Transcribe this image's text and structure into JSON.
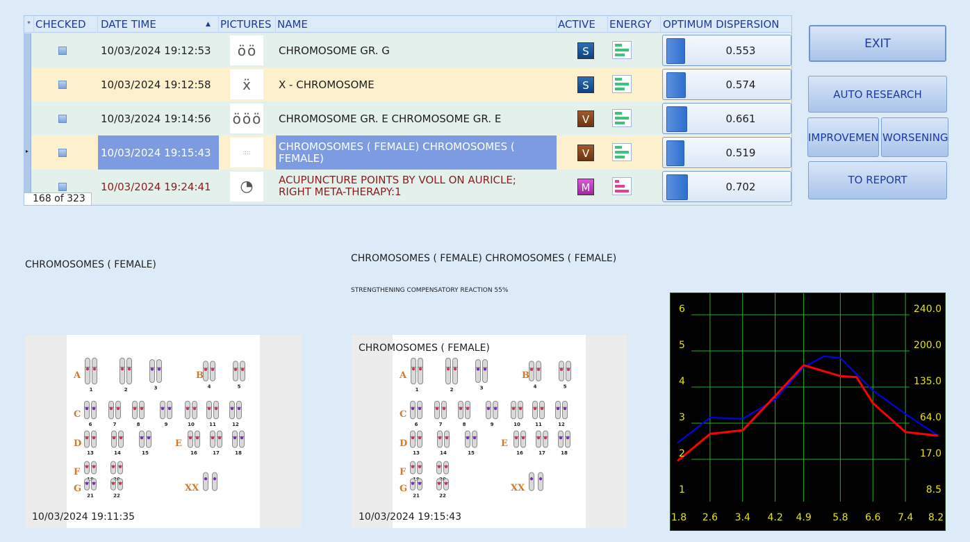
{
  "table": {
    "columns": [
      "CHECKED",
      "DATE  TIME",
      "PICTURES",
      "NAME",
      "ACTIVE",
      "ENERGY",
      "OPTIMUM DISPERSION"
    ],
    "rows": [
      {
        "datetime": "10/03/2024 19:12:53",
        "name": "CHROMOSOME GR. G",
        "active": "S",
        "dispersion": "0.553",
        "bar_level": 0.55
      },
      {
        "datetime": "10/03/2024 19:12:58",
        "name": "X - CHROMOSOME",
        "active": "S",
        "dispersion": "0.574",
        "bar_level": 0.57
      },
      {
        "datetime": "10/03/2024 19:14:56",
        "name": "CHROMOSOME GR. E CHROMOSOME GR. E",
        "active": "V",
        "dispersion": "0.661",
        "bar_level": 0.66
      },
      {
        "datetime": "10/03/2024 19:15:43",
        "name": "CHROMOSOMES ( FEMALE) CHROMOSOMES ( FEMALE)",
        "active": "V",
        "dispersion": "0.519",
        "bar_level": 0.52,
        "selected": true
      },
      {
        "datetime": "10/03/2024 19:24:41",
        "name": "ACUPUNCTURE POINTS BY VOLL ON AURICLE; RIGHT META-THERAPY:1",
        "active": "M",
        "dispersion": "0.702",
        "bar_level": 0.7
      }
    ],
    "counter": "168 of 323"
  },
  "buttons": {
    "exit": "EXIT",
    "auto_research": "AUTO RESEARCH",
    "improvement": "IMPROVEMENT",
    "worsening": "WORSENING",
    "to_report": "TO REPORT"
  },
  "captions": {
    "left_title": "CHROMOSOMES ( FEMALE)",
    "middle_title": "CHROMOSOMES ( FEMALE) CHROMOSOMES ( FEMALE)",
    "reaction": "STRENGTHENING COMPENSATORY REACTION 55%"
  },
  "panels": {
    "left": {
      "date": "10/03/2024 19:11:35"
    },
    "right": {
      "date": "10/03/2024 19:15:43",
      "overlay_title": "CHROMOSOMES ( FEMALE)"
    }
  },
  "karyotype": {
    "groups": [
      "A",
      "B",
      "C",
      "D",
      "E",
      "F",
      "G",
      "XX"
    ],
    "numbers": [
      "1",
      "2",
      "3",
      "4",
      "5",
      "6",
      "7",
      "8",
      "9",
      "10",
      "11",
      "12",
      "13",
      "14",
      "15",
      "16",
      "17",
      "18",
      "19",
      "20",
      "21",
      "22"
    ]
  },
  "graph": {
    "left_labels": [
      "6",
      "5",
      "4",
      "3",
      "2",
      "1"
    ],
    "right_labels": [
      "240.0",
      "200.0",
      "135.0",
      "64.0",
      "17.0",
      "8.5"
    ],
    "x_labels": [
      "1.8",
      "2.6",
      "3.4",
      "4.2",
      "4.9",
      "5.8",
      "6.6",
      "7.4",
      "8.2"
    ],
    "series": [
      {
        "color": "#0000ff",
        "points": [
          [
            1.8,
            2.3
          ],
          [
            2.6,
            3.0
          ],
          [
            3.4,
            2.97
          ],
          [
            4.2,
            3.5
          ],
          [
            4.9,
            4.4
          ],
          [
            5.4,
            4.7
          ],
          [
            5.8,
            4.65
          ],
          [
            6.6,
            3.75
          ],
          [
            7.4,
            3.1
          ],
          [
            8.2,
            2.5
          ]
        ]
      },
      {
        "color": "#ff0000",
        "points": [
          [
            1.8,
            1.8
          ],
          [
            2.6,
            2.55
          ],
          [
            3.4,
            2.65
          ],
          [
            4.2,
            3.6
          ],
          [
            4.9,
            4.45
          ],
          [
            5.8,
            4.15
          ],
          [
            6.2,
            4.12
          ],
          [
            6.6,
            3.4
          ],
          [
            7.4,
            2.6
          ],
          [
            8.2,
            2.5
          ]
        ]
      }
    ]
  },
  "colors": {
    "background": "#ddeaf8",
    "selected_row": "#7c9be0",
    "header_text": "#1c3aa0",
    "graph_grid": "#1fb51f",
    "graph_labels": "#e6e600"
  }
}
